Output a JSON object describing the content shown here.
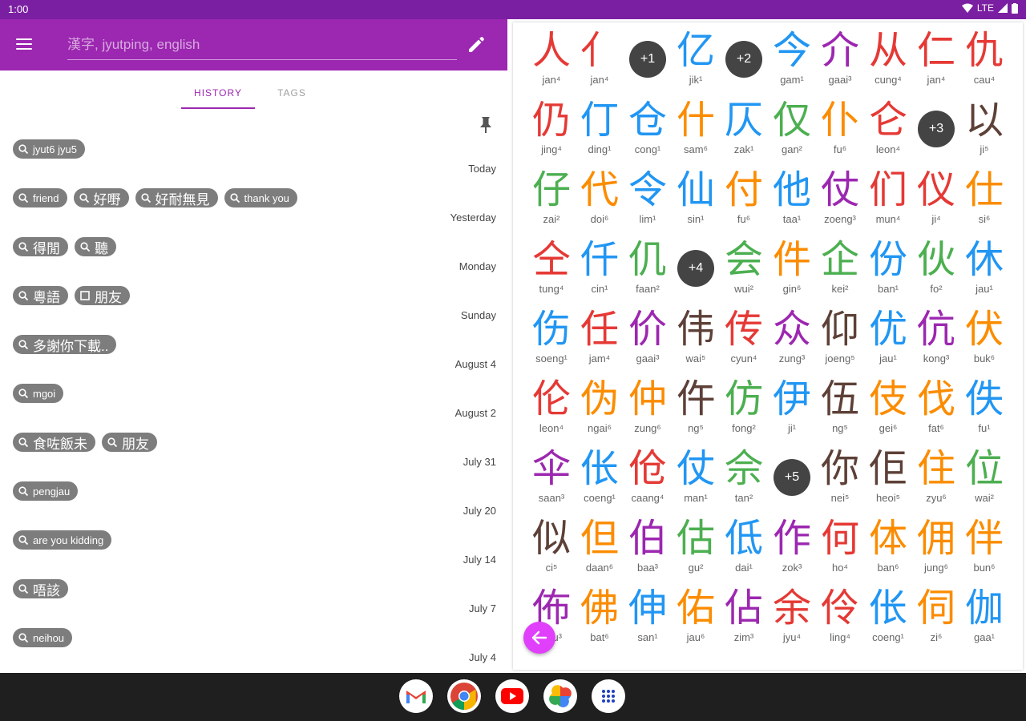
{
  "status_bar": {
    "time": "1:00",
    "network": "LTE"
  },
  "search": {
    "placeholder": "漢字, jyutping, english"
  },
  "tabs": [
    {
      "label": "HISTORY",
      "active": true
    },
    {
      "label": "TAGS",
      "active": false
    }
  ],
  "history": [
    {
      "date": "",
      "chips": [
        {
          "text": "jyut6 jyu5",
          "icon": "search-icon"
        }
      ]
    },
    {
      "date": "Today",
      "chips": [
        {
          "text": "friend",
          "icon": "search-icon"
        },
        {
          "text": "好嘢",
          "icon": "search-icon"
        },
        {
          "text": "好耐無見",
          "icon": "search-icon"
        },
        {
          "text": "thank you",
          "icon": "search-icon"
        }
      ]
    },
    {
      "date": "Yesterday",
      "chips": [
        {
          "text": "得閒",
          "icon": "search-icon"
        },
        {
          "text": "聽",
          "icon": "search-icon"
        }
      ]
    },
    {
      "date": "Monday",
      "chips": [
        {
          "text": "粵語",
          "icon": "search-icon"
        },
        {
          "text": "朋友",
          "icon": "square-icon"
        }
      ]
    },
    {
      "date": "Sunday",
      "chips": [
        {
          "text": "多謝你下載..",
          "icon": "search-icon"
        }
      ]
    },
    {
      "date": "August 4",
      "chips": [
        {
          "text": "mgoi",
          "icon": "search-icon"
        }
      ]
    },
    {
      "date": "August 2",
      "chips": [
        {
          "text": "食咗飯未",
          "icon": "search-icon"
        },
        {
          "text": "朋友",
          "icon": "search-icon"
        }
      ]
    },
    {
      "date": "July 31",
      "chips": [
        {
          "text": "pengjau",
          "icon": "search-icon"
        }
      ]
    },
    {
      "date": "July 20",
      "chips": [
        {
          "text": "are you kidding",
          "icon": "search-icon"
        }
      ]
    },
    {
      "date": "July 14",
      "chips": [
        {
          "text": "唔該",
          "icon": "search-icon"
        }
      ]
    },
    {
      "date": "July 7",
      "chips": [
        {
          "text": "neihou",
          "icon": "search-icon"
        }
      ]
    },
    {
      "date": "July 4",
      "chips": []
    }
  ],
  "tone_colors": {
    "1": "#2196f3",
    "2": "#4caf50",
    "3": "#9c27b0",
    "4": "#e53935",
    "5": "#5d4037",
    "6": "#fb8c00"
  },
  "characters": [
    [
      {
        "hz": "人",
        "jp": "jan⁴"
      },
      {
        "hz": "亻",
        "jp": "jan⁴"
      },
      {
        "more": "+1"
      },
      {
        "hz": "亿",
        "jp": "jik¹"
      },
      {
        "more": "+2"
      },
      {
        "hz": "今",
        "jp": "gam¹"
      },
      {
        "hz": "介",
        "jp": "gaai³"
      },
      {
        "hz": "从",
        "jp": "cung⁴"
      },
      {
        "hz": "仁",
        "jp": "jan⁴"
      },
      {
        "hz": "仇",
        "jp": "cau⁴"
      }
    ],
    [
      {
        "hz": "仍",
        "jp": "jing⁴"
      },
      {
        "hz": "仃",
        "jp": "ding¹"
      },
      {
        "hz": "仓",
        "jp": "cong¹"
      },
      {
        "hz": "什",
        "jp": "sam⁶"
      },
      {
        "hz": "仄",
        "jp": "zak¹"
      },
      {
        "hz": "仅",
        "jp": "gan²"
      },
      {
        "hz": "仆",
        "jp": "fu⁶"
      },
      {
        "hz": "仑",
        "jp": "leon⁴"
      },
      {
        "more": "+3"
      },
      {
        "hz": "以",
        "jp": "ji⁵"
      }
    ],
    [
      {
        "hz": "仔",
        "jp": "zai²"
      },
      {
        "hz": "代",
        "jp": "doi⁶"
      },
      {
        "hz": "令",
        "jp": "lim¹"
      },
      {
        "hz": "仙",
        "jp": "sin¹"
      },
      {
        "hz": "付",
        "jp": "fu⁶"
      },
      {
        "hz": "他",
        "jp": "taa¹"
      },
      {
        "hz": "仗",
        "jp": "zoeng³"
      },
      {
        "hz": "们",
        "jp": "mun⁴"
      },
      {
        "hz": "仪",
        "jp": "ji⁴"
      },
      {
        "hz": "仕",
        "jp": "si⁶"
      }
    ],
    [
      {
        "hz": "仝",
        "jp": "tung⁴"
      },
      {
        "hz": "仟",
        "jp": "cin¹"
      },
      {
        "hz": "仉",
        "jp": "faan²"
      },
      {
        "more": "+4"
      },
      {
        "hz": "会",
        "jp": "wui²"
      },
      {
        "hz": "件",
        "jp": "gin⁶"
      },
      {
        "hz": "企",
        "jp": "kei²"
      },
      {
        "hz": "份",
        "jp": "ban¹"
      },
      {
        "hz": "伙",
        "jp": "fo²"
      },
      {
        "hz": "休",
        "jp": "jau¹"
      }
    ],
    [
      {
        "hz": "伤",
        "jp": "soeng¹"
      },
      {
        "hz": "任",
        "jp": "jam⁴"
      },
      {
        "hz": "价",
        "jp": "gaai³"
      },
      {
        "hz": "伟",
        "jp": "wai⁵"
      },
      {
        "hz": "传",
        "jp": "cyun⁴"
      },
      {
        "hz": "众",
        "jp": "zung³"
      },
      {
        "hz": "仰",
        "jp": "joeng⁵"
      },
      {
        "hz": "优",
        "jp": "jau¹"
      },
      {
        "hz": "伉",
        "jp": "kong³"
      },
      {
        "hz": "伏",
        "jp": "buk⁶"
      }
    ],
    [
      {
        "hz": "伦",
        "jp": "leon⁴"
      },
      {
        "hz": "伪",
        "jp": "ngai⁶"
      },
      {
        "hz": "仲",
        "jp": "zung⁶"
      },
      {
        "hz": "仵",
        "jp": "ng⁵"
      },
      {
        "hz": "仿",
        "jp": "fong²"
      },
      {
        "hz": "伊",
        "jp": "ji¹"
      },
      {
        "hz": "伍",
        "jp": "ng⁵"
      },
      {
        "hz": "伎",
        "jp": "gei⁶"
      },
      {
        "hz": "伐",
        "jp": "fat⁶"
      },
      {
        "hz": "佚",
        "jp": "fu¹"
      }
    ],
    [
      {
        "hz": "伞",
        "jp": "saan³"
      },
      {
        "hz": "伥",
        "jp": "coeng¹"
      },
      {
        "hz": "伧",
        "jp": "caang⁴"
      },
      {
        "hz": "仗",
        "jp": "man¹"
      },
      {
        "hz": "佘",
        "jp": "tan²"
      },
      {
        "more": "+5"
      },
      {
        "hz": "你",
        "jp": "nei⁵"
      },
      {
        "hz": "佢",
        "jp": "heoi⁵"
      },
      {
        "hz": "住",
        "jp": "zyu⁶"
      },
      {
        "hz": "位",
        "jp": "wai²"
      }
    ],
    [
      {
        "hz": "似",
        "jp": "ci⁵"
      },
      {
        "hz": "但",
        "jp": "daan⁶"
      },
      {
        "hz": "伯",
        "jp": "baa³"
      },
      {
        "hz": "估",
        "jp": "gu²"
      },
      {
        "hz": "低",
        "jp": "dai¹"
      },
      {
        "hz": "作",
        "jp": "zok³"
      },
      {
        "hz": "何",
        "jp": "ho⁴"
      },
      {
        "hz": "体",
        "jp": "ban⁶"
      },
      {
        "hz": "佣",
        "jp": "jung⁶"
      },
      {
        "hz": "伴",
        "jp": "bun⁶"
      }
    ],
    [
      {
        "hz": "佈",
        "jp": "bou³"
      },
      {
        "hz": "佛",
        "jp": "bat⁶"
      },
      {
        "hz": "伸",
        "jp": "san¹"
      },
      {
        "hz": "佑",
        "jp": "jau⁶"
      },
      {
        "hz": "佔",
        "jp": "zim³"
      },
      {
        "hz": "余",
        "jp": "jyu⁴"
      },
      {
        "hz": "伶",
        "jp": "ling⁴"
      },
      {
        "hz": "伥",
        "jp": "coeng¹"
      },
      {
        "hz": "伺",
        "jp": "zi⁶"
      },
      {
        "hz": "伽",
        "jp": "gaa¹"
      }
    ]
  ]
}
